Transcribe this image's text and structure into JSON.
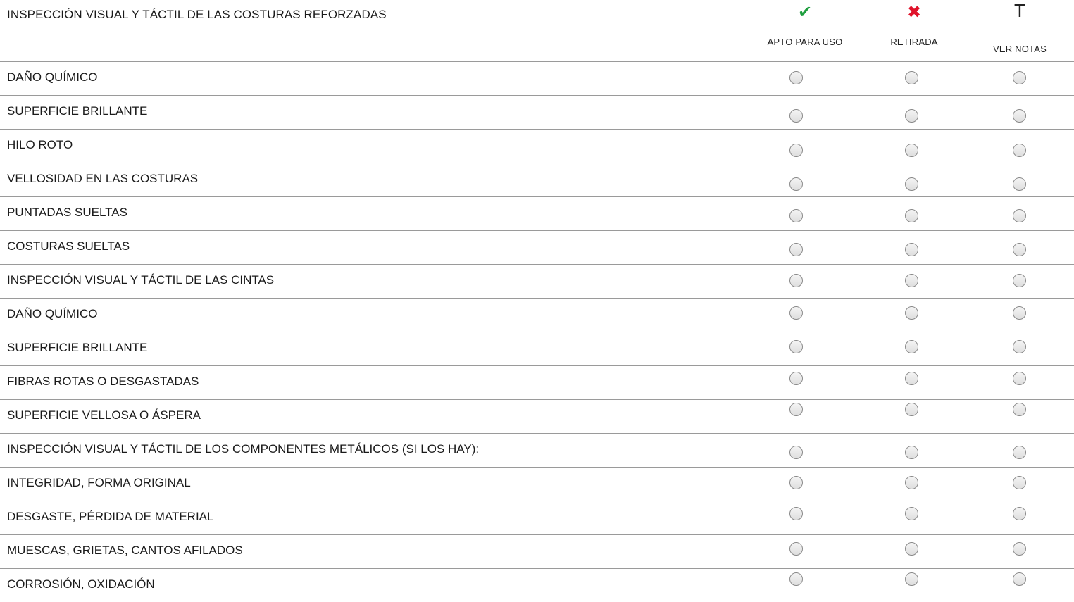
{
  "header": {
    "title": "INSPECCIÓN VISUAL Y TÁCTIL DE LAS COSTURAS REFORZADAS",
    "columns": [
      {
        "icon": "check-icon",
        "glyph": "✔",
        "label": "APTO PARA USO",
        "color": "#1e9e3e"
      },
      {
        "icon": "cross-icon",
        "glyph": "✖",
        "label": "RETIRADA",
        "color": "#e0132b"
      },
      {
        "icon": "text-t-icon",
        "glyph": "T",
        "label": "VER NOTAS",
        "color": "#222222"
      }
    ]
  },
  "rows": [
    {
      "label": "DAÑO QUÍMICO"
    },
    {
      "label": "SUPERFICIE BRILLANTE"
    },
    {
      "label": "HILO ROTO"
    },
    {
      "label": "VELLOSIDAD EN LAS COSTURAS"
    },
    {
      "label": "PUNTADAS SUELTAS"
    },
    {
      "label": "COSTURAS SUELTAS"
    },
    {
      "label": "INSPECCIÓN VISUAL Y TÁCTIL DE LAS CINTAS"
    },
    {
      "label": "DAÑO QUÍMICO"
    },
    {
      "label": "SUPERFICIE BRILLANTE"
    },
    {
      "label": "FIBRAS ROTAS O DESGASTADAS"
    },
    {
      "label": "SUPERFICIE VELLOSA O ÁSPERA"
    },
    {
      "label": "INSPECCIÓN VISUAL Y TÁCTIL DE LOS COMPONENTES METÁLICOS (SI LOS HAY):"
    },
    {
      "label": "INTEGRIDAD, FORMA ORIGINAL"
    },
    {
      "label": "DESGASTE, PÉRDIDA DE MATERIAL"
    },
    {
      "label": "MUESCAS, GRIETAS, CANTOS AFILADOS"
    },
    {
      "label": "CORROSIÓN, OXIDACIÓN"
    }
  ]
}
